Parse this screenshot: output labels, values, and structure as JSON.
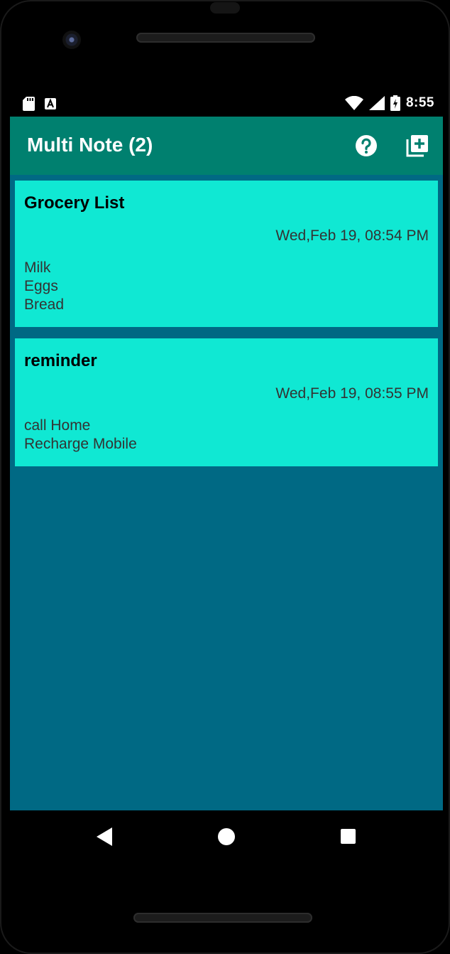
{
  "status_bar": {
    "time": "8:55",
    "icons": [
      "sd-card-icon",
      "text-a-icon",
      "wifi-icon",
      "signal-icon",
      "battery-charging-icon"
    ]
  },
  "app_bar": {
    "title": "Multi Note (2)",
    "actions": [
      "help-icon",
      "add-note-icon"
    ]
  },
  "notes": [
    {
      "title": "Grocery List",
      "date": "Wed,Feb 19, 08:54 PM",
      "body": "Milk\nEggs\nBread"
    },
    {
      "title": "reminder",
      "date": "Wed,Feb 19, 08:55 PM",
      "body": "call Home\nRecharge Mobile"
    }
  ],
  "nav_bar": {
    "buttons": [
      "back-icon",
      "home-icon",
      "recents-icon"
    ]
  },
  "colors": {
    "app_bar": "#00806f",
    "list_background": "#006984",
    "card_background": "#10e8d3"
  }
}
